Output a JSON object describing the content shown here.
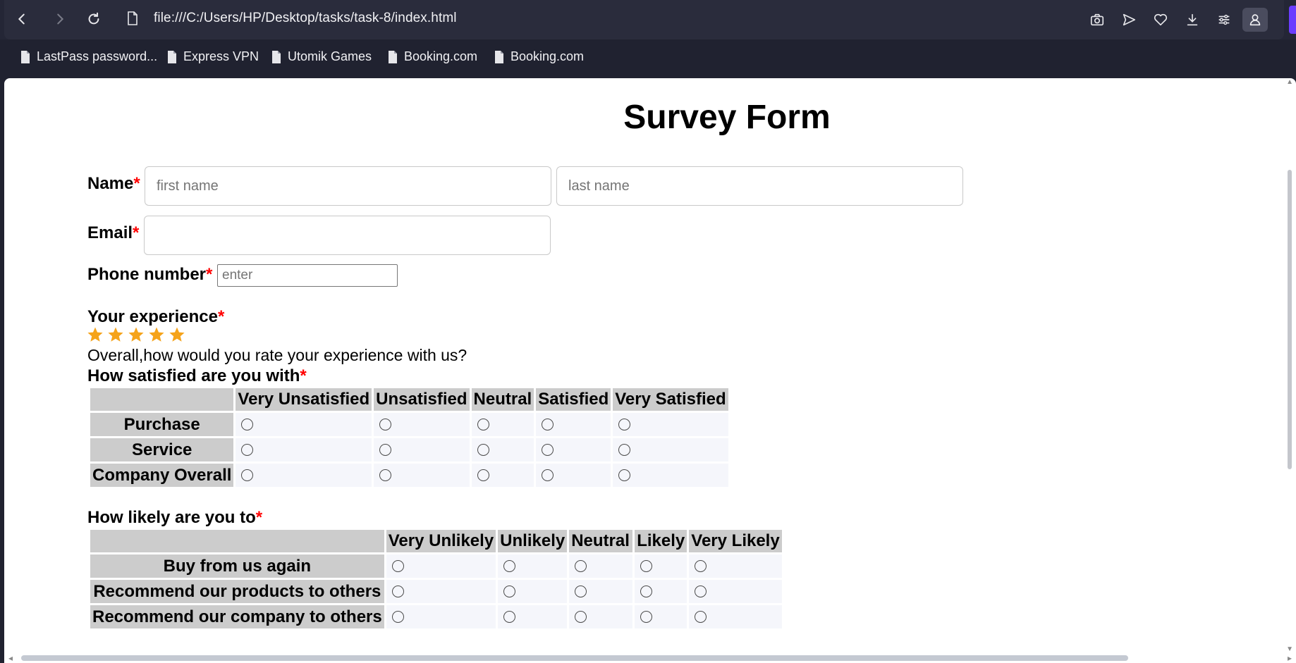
{
  "browser": {
    "url": "file:///C:/Users/HP/Desktop/tasks/task-8/index.html",
    "bookmarks": [
      {
        "label": "LastPass password..."
      },
      {
        "label": "Express VPN"
      },
      {
        "label": "Utomik Games"
      },
      {
        "label": "Booking.com"
      },
      {
        "label": "Booking.com"
      }
    ],
    "accent_color": "#6b3cff"
  },
  "form": {
    "title": "Survey Form",
    "required_marker": "*",
    "name": {
      "label": "Name",
      "first_placeholder": "first name",
      "last_placeholder": "last name"
    },
    "email": {
      "label": "Email",
      "value": ""
    },
    "phone": {
      "label": "Phone number",
      "placeholder": "enter"
    },
    "experience": {
      "label": "Your experience",
      "stars": 5,
      "star_color": "#f5a31a",
      "question": "Overall,how would you rate your experience with us?"
    },
    "satisfaction": {
      "label": "How satisfied are you with",
      "columns": [
        "Very Unsatisfied",
        "Unsatisfied",
        "Neutral",
        "Satisfied",
        "Very Satisfied"
      ],
      "rows": [
        "Purchase",
        "Service",
        "Company Overall"
      ]
    },
    "likelihood": {
      "label": "How likely are you to",
      "columns": [
        "Very Unlikely",
        "Unlikely",
        "Neutral",
        "Likely",
        "Very Likely"
      ],
      "rows": [
        "Buy from us again",
        "Recommend our products to others",
        "Recommend our company to others"
      ]
    }
  }
}
